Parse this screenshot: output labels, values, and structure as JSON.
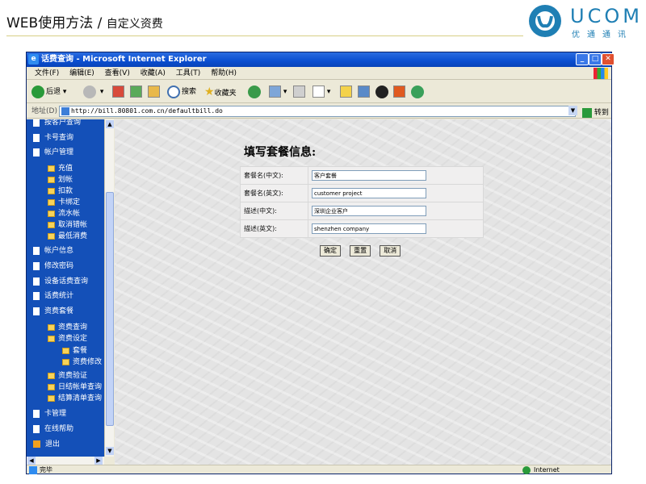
{
  "slide": {
    "title_main": "WEB使用方法 / ",
    "title_sub": "自定义资费",
    "logo_text": "UCOM",
    "logo_sub": "优通通讯"
  },
  "browser": {
    "window_title": "话费查询 - Microsoft Internet Explorer",
    "menu": [
      "文件(F)",
      "编辑(E)",
      "查看(V)",
      "收藏(A)",
      "工具(T)",
      "帮助(H)"
    ],
    "toolbar": {
      "back": "后退",
      "search": "搜索",
      "favorites": "收藏夹"
    },
    "address_label": "地址(D)",
    "address_url": "http://bill.80801.com.cn/defaultbill.do",
    "go_label": "转到",
    "status_text": "完毕",
    "zone_text": "Internet"
  },
  "sidebar": {
    "items": [
      {
        "label": "按客户查询",
        "level": 0
      },
      {
        "label": "卡号查询",
        "level": 0
      },
      {
        "label": "帐户管理",
        "level": 0
      },
      {
        "label": "充值",
        "level": 1
      },
      {
        "label": "划帐",
        "level": 1
      },
      {
        "label": "扣款",
        "level": 1
      },
      {
        "label": "卡绑定",
        "level": 1
      },
      {
        "label": "流水帐",
        "level": 1
      },
      {
        "label": "取消错帐",
        "level": 1
      },
      {
        "label": "最低消费",
        "level": 1
      },
      {
        "label": "帐户信息",
        "level": 0
      },
      {
        "label": "修改密码",
        "level": 0
      },
      {
        "label": "设备话费查询",
        "level": 0
      },
      {
        "label": "话费统计",
        "level": 0
      },
      {
        "label": "资费套餐",
        "level": 0
      },
      {
        "label": "资费查询",
        "level": 1
      },
      {
        "label": "资费设定",
        "level": 1
      },
      {
        "label": "套餐",
        "level": 2
      },
      {
        "label": "资费修改",
        "level": 2
      },
      {
        "label": "资费验证",
        "level": 1
      },
      {
        "label": "日结帐单查询",
        "level": 1
      },
      {
        "label": "结算清单查询",
        "level": 1
      },
      {
        "label": "卡管理",
        "level": 0
      },
      {
        "label": "在线帮助",
        "level": 0
      },
      {
        "label": "退出",
        "level": 0
      }
    ]
  },
  "form": {
    "title": "填写套餐信息:",
    "rows": [
      {
        "label": "套餐名(中文):",
        "value": "客户套餐"
      },
      {
        "label": "套餐名(英文):",
        "value": "customer project"
      },
      {
        "label": "描述(中文):",
        "value": "深圳企业客户"
      },
      {
        "label": "描述(英文):",
        "value": "shenzhen company"
      }
    ],
    "buttons": {
      "confirm": "确定",
      "reset": "重置",
      "cancel": "取消"
    }
  },
  "colors": {
    "sidebar_bg": "#1450b8",
    "titlebar": "#0a4ed0",
    "logo": "#1f7fb4"
  }
}
